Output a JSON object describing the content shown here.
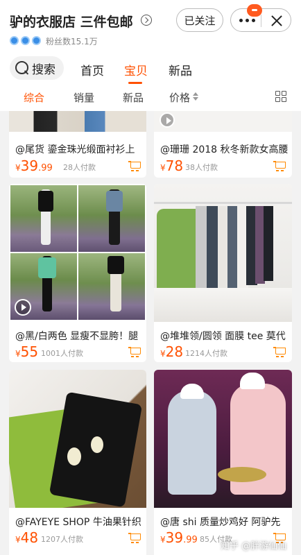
{
  "shop": {
    "title": "驴的衣服店 三件包邮",
    "fans": "粉丝数15.1万",
    "follow_label": "已关注"
  },
  "nav": {
    "search_label": "搜索",
    "tabs": [
      "首页",
      "宝贝",
      "新品"
    ],
    "active_tab": "宝贝"
  },
  "sort": {
    "items": [
      "综合",
      "销量",
      "新品",
      "价格"
    ],
    "active": "综合"
  },
  "products": [
    {
      "title": "@尾货 鎏金珠光缎面衬衫上",
      "currency": "¥",
      "price_int": "39",
      "price_dec": ".99",
      "sold": "28人付款"
    },
    {
      "title": "@珊珊 2018 秋冬新款女高腰",
      "currency": "¥",
      "price_int": "78",
      "price_dec": "",
      "sold": "38人付款"
    },
    {
      "title": "@黑/白两色 显瘦不显胯！腿",
      "currency": "¥",
      "price_int": "55",
      "price_dec": "",
      "sold": "1001人付款"
    },
    {
      "title": "@堆堆领/圆领 面膜 tee 莫代",
      "currency": "¥",
      "price_int": "28",
      "price_dec": "",
      "sold": "1214人付款"
    },
    {
      "title": "@FAYEYE SHOP 牛油果针织",
      "currency": "¥",
      "price_int": "48",
      "price_dec": "",
      "sold": "1207人付款"
    },
    {
      "title": "@唐 shi 质量炒鸡好 阿驴先",
      "currency": "¥",
      "price_int": "39",
      "price_dec": ".99",
      "sold": "85人付款"
    }
  ],
  "watermark": "知乎 @胖游仙仙",
  "colors": {
    "accent": "#ff5000",
    "cart": "#ff8a00",
    "background": "#f2f2f2"
  },
  "icons": [
    "verified-badge-icon",
    "chevron-right-icon",
    "more-dots-icon",
    "close-icon",
    "search-icon",
    "sort-arrows-icon",
    "grid-view-icon",
    "play-icon",
    "cart-icon"
  ]
}
